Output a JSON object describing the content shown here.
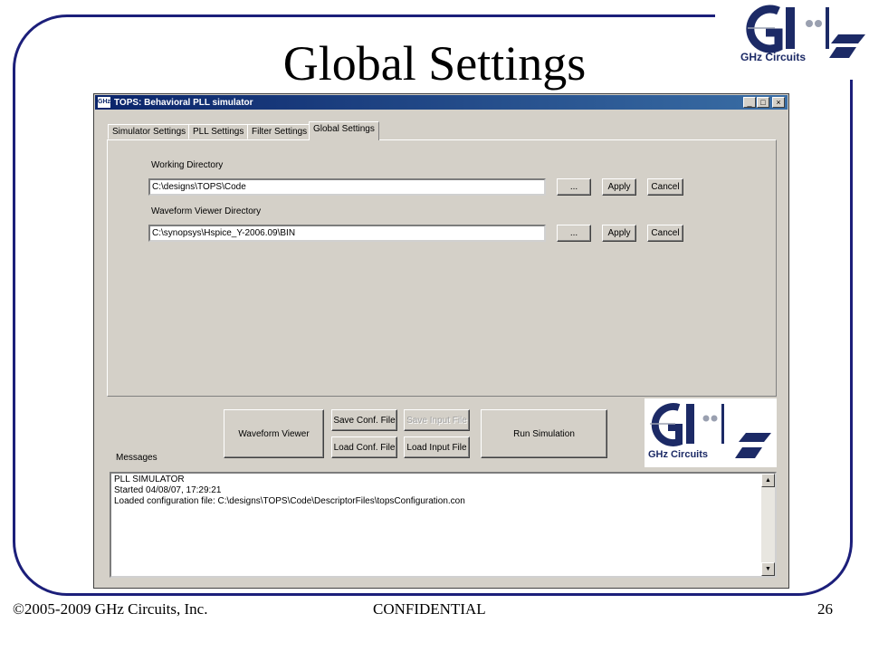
{
  "slide": {
    "title": "Global Settings",
    "logo_text": "GHz Circuits",
    "footer_left": "©2005-2009 GHz  Circuits, Inc.",
    "footer_center": "CONFIDENTIAL",
    "footer_right": "26",
    "colors": {
      "frame": "#1c1f7a",
      "logo_navy": "#1c2a66"
    }
  },
  "window": {
    "icon_label": "GHz",
    "title": "TOPS: Behavioral PLL simulator",
    "controls": {
      "minimize": "_",
      "maximize": "□",
      "close": "×"
    },
    "colors": {
      "titlebar_start": "#0a246a",
      "titlebar_end": "#3a6ea5",
      "face": "#d4d0c8"
    }
  },
  "tabs": [
    {
      "label": "Simulator Settings",
      "active": false
    },
    {
      "label": "PLL Settings",
      "active": false
    },
    {
      "label": "Filter Settings",
      "active": false
    },
    {
      "label": "Global Settings",
      "active": true
    }
  ],
  "settings": {
    "working_dir": {
      "label": "Working Directory",
      "value": "C:\\designs\\TOPS\\Code",
      "browse": "...",
      "apply": "Apply",
      "cancel": "Cancel"
    },
    "waveform_dir": {
      "label": "Waveform Viewer Directory",
      "value": "C:\\synopsys\\Hspice_Y-2006.09\\BIN",
      "browse": "...",
      "apply": "Apply",
      "cancel": "Cancel"
    }
  },
  "actions": {
    "waveform_viewer": "Waveform Viewer",
    "save_conf": "Save Conf. File",
    "load_conf": "Load Conf. File",
    "save_input": "Save Input File",
    "save_input_enabled": false,
    "load_input": "Load Input File",
    "run_simulation": "Run Simulation"
  },
  "messages": {
    "label": "Messages",
    "lines": [
      "PLL SIMULATOR",
      "Started 04/08/07, 17:29:21",
      "Loaded configuration file: C:\\designs\\TOPS\\Code\\DescriptorFiles\\topsConfiguration.con"
    ],
    "scroll_up": "▲",
    "scroll_down": "▼"
  }
}
